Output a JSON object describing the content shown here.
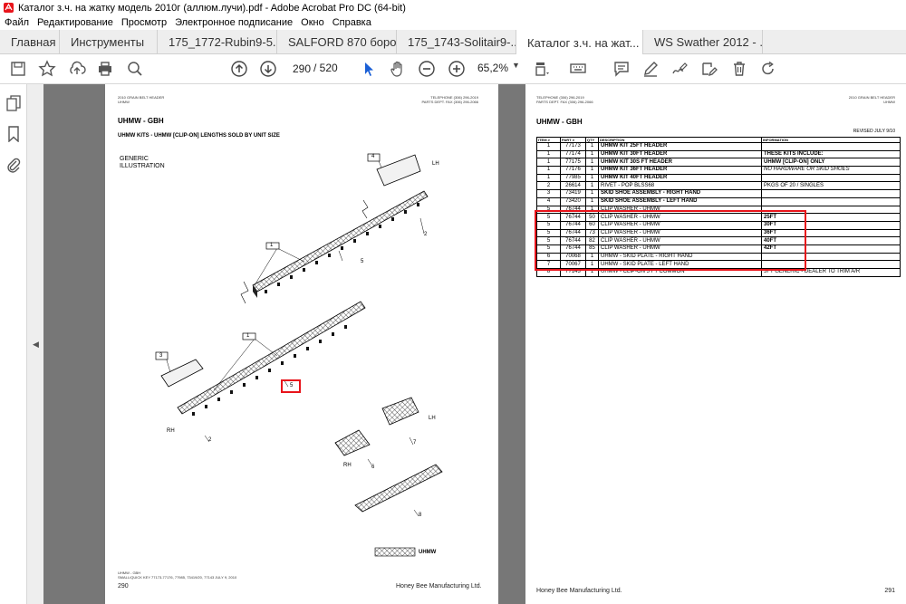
{
  "window": {
    "title": "Каталог з.ч. на жатку модель 2010г (аллюм.лучи).pdf - Adobe Acrobat Pro DC (64-bit)"
  },
  "menu": [
    "Файл",
    "Редактирование",
    "Просмотр",
    "Электронное подписание",
    "Окно",
    "Справка"
  ],
  "tabs": {
    "home": "Главная",
    "tools": "Инструменты",
    "docs": [
      "175_1772-Rubin9-5...",
      "SALFORD 870 боро...",
      "175_1743-Solitair9-...",
      "Каталог з.ч. на жат...",
      "WS Swather 2012 - ..."
    ],
    "close_glyph": "✕"
  },
  "toolbar": {
    "page_current": "290",
    "page_total": "/  520",
    "zoom": "65,2%"
  },
  "left_page": {
    "header_left_1": "2010 GRAIN BELT HEADER",
    "header_left_2": "UHMW",
    "header_right_1": "TELEPHONE (306) 296-2019",
    "header_right_2": "PARTS DEPT. FAX (306) 296-2066",
    "title": "UHMW - GBH",
    "subtitle": "UHMW KITS - UHMW [CLIP-ON] LENGTHS SOLD BY UNIT SIZE",
    "illus_label_1": "GENERIC",
    "illus_label_2": "ILLUSTRATION",
    "callouts": {
      "c1a": "1",
      "c1b": "1",
      "c2a": "2",
      "c2b": "2",
      "c3": "3",
      "c4": "4",
      "c5a": "5",
      "c5b": "5",
      "c6": "6",
      "c7": "7",
      "c8": "8",
      "lh1": "LH",
      "lh2": "LH",
      "rh1": "RH",
      "rh2": "RH"
    },
    "legend_label": "UHMW",
    "footnote_1": "UHMW - GBH",
    "footnote_2": "SMALL/QUICK KEY 77173-77176, 77985, 73419/20, 77143 JULY 9, 2010",
    "page_num": "290",
    "company": "Honey Bee Manufacturing Ltd."
  },
  "right_page": {
    "header_left_1": "TELEPHONE (306) 296-2019",
    "header_left_2": "PARTS DEPT. FAX (306) 296-2066",
    "header_right_1": "2010 GRAIN BELT HEADER",
    "header_right_2": "UHMW",
    "title": "UHMW - GBH",
    "revised": "REVISED JULY 9/10",
    "columns": [
      "ITEM #",
      "PART #",
      "QTY",
      "DESCRIPTION",
      "INFORMATION"
    ],
    "rows": [
      [
        "1",
        "77173",
        "1",
        "UHMW KIT 25FT HEADER",
        ""
      ],
      [
        "1",
        "77174",
        "1",
        "UHMW KIT 30FT HEADER",
        "THESE KITS INCLUDE:"
      ],
      [
        "1",
        "77175",
        "1",
        "UHMW KIT 30S FT HEADER",
        "UHMW [CLIP-ON] ONLY"
      ],
      [
        "1",
        "77176",
        "1",
        "UHMW KIT 36FT HEADER",
        "NO HARDWARE OR SKID SHOES"
      ],
      [
        "1",
        "77985",
        "1",
        "UHMW KIT 40FT HEADER",
        ""
      ],
      [
        "2",
        "26614",
        "1",
        "RIVET - POP BLSS68",
        "PKGS OF 20 / SINGLES"
      ],
      [
        "3",
        "73419",
        "1",
        "SKID SHOE ASSEMBLY - RIGHT HAND",
        ""
      ],
      [
        "4",
        "73420",
        "1",
        "SKID SHOE ASSEMBLY - LEFT HAND",
        ""
      ],
      [
        "5",
        "76744",
        "1",
        "CLIP WASHER - UHMW",
        ""
      ],
      [
        "5",
        "76744",
        "50",
        "CLIP WASHER - UHMW",
        "25FT"
      ],
      [
        "5",
        "76744",
        "60",
        "CLIP WASHER - UHMW",
        "30FT"
      ],
      [
        "5",
        "76744",
        "73",
        "CLIP WASHER - UHMW",
        "36FT"
      ],
      [
        "5",
        "76744",
        "82",
        "CLIP WASHER - UHMW",
        "40FT"
      ],
      [
        "5",
        "76744",
        "85",
        "CLIP WASHER - UHMW",
        "42FT"
      ],
      [
        "6",
        "70068",
        "1",
        "UHMW - SKID PLATE - RIGHT HAND",
        ""
      ],
      [
        "7",
        "70067",
        "1",
        "UHMW - SKID PLATE - LEFT HAND",
        ""
      ],
      [
        "8",
        "77143",
        "1",
        "UHMW - CLIP-ON 5 FT COMMON",
        "5FT GENERIC - DEALER TO TRIM A/R"
      ]
    ],
    "company": "Honey Bee Manufacturing Ltd.",
    "page_num": "291"
  },
  "colors": {
    "accent": "#e8141b",
    "doc_bg": "#777777"
  },
  "icons": [
    "acrobat-app-icon",
    "save-icon",
    "bookmark-star-icon",
    "upload-cloud-icon",
    "print-icon",
    "zoom-search-icon",
    "page-up-icon",
    "page-down-icon",
    "select-arrow-icon",
    "hand-icon",
    "zoom-out-icon",
    "zoom-in-icon",
    "page-fit-icon",
    "keyboard-icon",
    "comment-icon",
    "pen-icon",
    "sign-icon",
    "edit-stamp-icon",
    "trash-icon",
    "rotate-icon",
    "pages-icon",
    "bookmark-icon",
    "attachment-icon"
  ]
}
